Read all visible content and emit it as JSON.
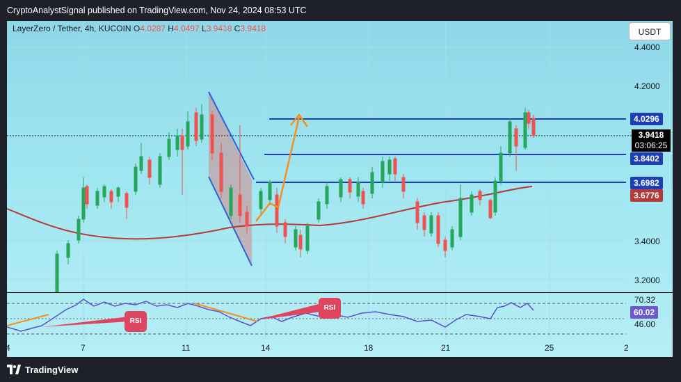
{
  "header": {
    "publish_line": "CryptoAnalystSignal published on TradingView.com, Nov 24, 2024 08:53 UTC"
  },
  "symbol": {
    "pair": "LayerZero / Tether, 4h, KUCOIN",
    "o_label": "O",
    "o_value": "4.0287",
    "h_label": "H",
    "h_value": "4.0497",
    "l_label": "L",
    "l_value": "3.9418",
    "c_label": "C",
    "c_value": "3.9418"
  },
  "currency_button": "USDT",
  "price_axis": [
    "4.4000",
    "4.2000",
    "3.4000",
    "3.2000"
  ],
  "level_tags": {
    "resistance": "4.0296",
    "support_mid": "3.8402",
    "support_low": "3.6982",
    "ma_value": "3.6776"
  },
  "current_price": {
    "price": "3.9418",
    "countdown": "03:06:25"
  },
  "rsi_axis": {
    "upper": "70.32",
    "current": "60.02",
    "lower": "46.00"
  },
  "rsi_labels": [
    "RSI",
    "RSI"
  ],
  "date_axis": [
    "4",
    "7",
    "11",
    "14",
    "18",
    "21",
    "25",
    "2"
  ],
  "footer": {
    "brand": "TradingView"
  },
  "colors": {
    "bull": "#26a65b",
    "bear": "#ef5350",
    "level_line": "#1e3fb4",
    "ma": "#b53a3a",
    "arrow": "#f5901e",
    "channel": "#2f5fd8",
    "rsi_pill": "#e0455f"
  }
}
